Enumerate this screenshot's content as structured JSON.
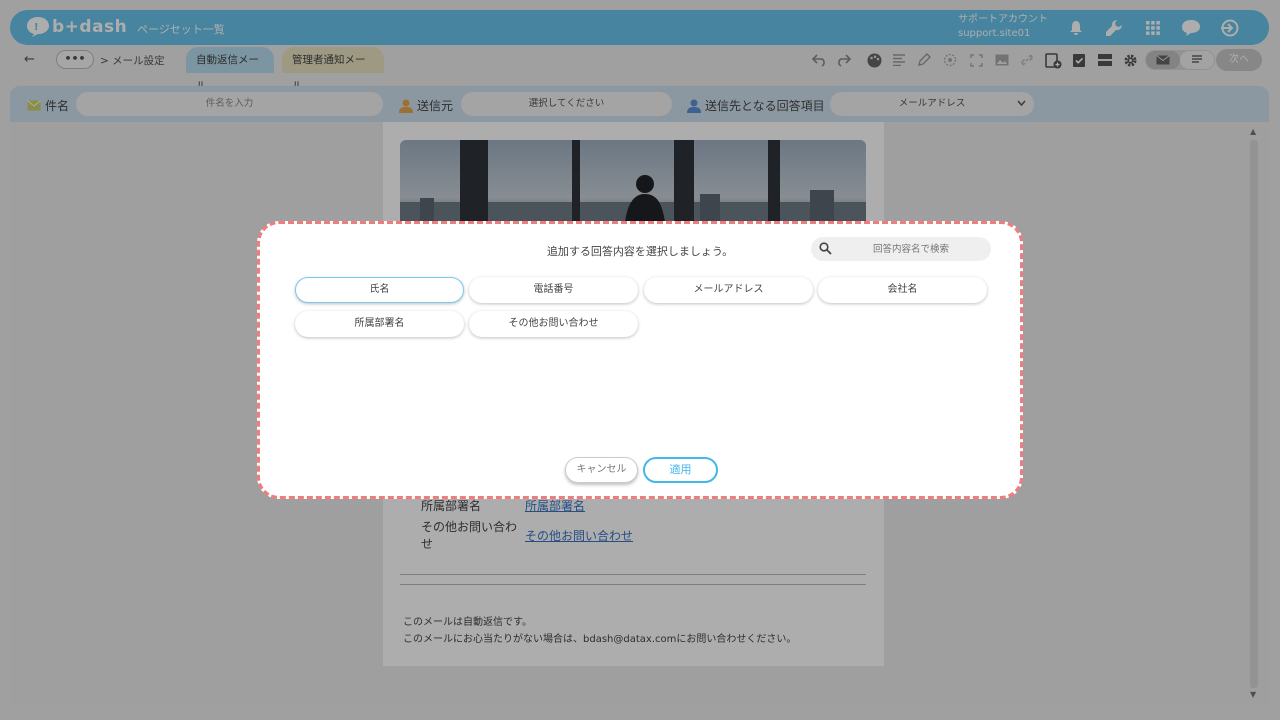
{
  "header": {
    "logo_text": "b+dash",
    "page_set_link": "ページセット一覧",
    "account_line1": "サポートアカウント",
    "account_line2": "support.site01",
    "icons": [
      "bell-icon",
      "wrench-icon",
      "apps-grid-icon",
      "chat-icon",
      "logout-icon"
    ]
  },
  "toolbar": {
    "more_label": "•••",
    "breadcrumb": "> メール設定",
    "tabs": [
      {
        "label": "自動返信メール",
        "active": true
      },
      {
        "label": "管理者通知メール",
        "active": false
      }
    ],
    "next_label": "次へ"
  },
  "settings": {
    "subject_label": "件名",
    "subject_placeholder": "件名を入力",
    "sender_label": "送信元",
    "sender_value": "選択してください",
    "recipient_label": "送信先となる回答項目",
    "recipient_value": "メールアドレス"
  },
  "mail_body": {
    "rows": [
      {
        "label": "所属部署名",
        "link": "所属部署名"
      },
      {
        "label": "その他お問い合わせ",
        "link": "その他お問い合わせ"
      }
    ],
    "footer_line1": "このメールは自動返信です。",
    "footer_line2": "このメールにお心当たりがない場合は、bdash@datax.comにお問い合わせください。"
  },
  "modal": {
    "title": "追加する回答内容を選択しましょう。",
    "search_placeholder": "回答内容名で検索",
    "options": [
      {
        "label": "氏名",
        "selected": true
      },
      {
        "label": "電話番号",
        "selected": false
      },
      {
        "label": "メールアドレス",
        "selected": false
      },
      {
        "label": "会社名",
        "selected": false
      },
      {
        "label": "所属部署名",
        "selected": false
      },
      {
        "label": "その他お問い合わせ",
        "selected": false
      }
    ],
    "cancel_label": "キャンセル",
    "apply_label": "適用"
  },
  "colors": {
    "brand": "#68c3ea",
    "accent": "#43b7ea",
    "highlight_border": "#f07d7d"
  }
}
